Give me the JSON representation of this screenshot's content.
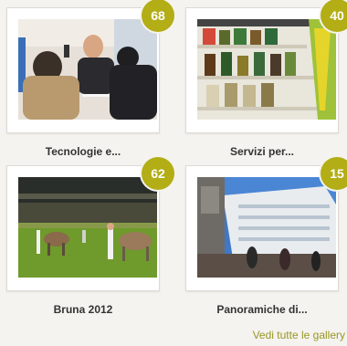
{
  "galleries": [
    {
      "title": "Tecnologie e...",
      "count": "68",
      "thumb_icon": "conference-photo"
    },
    {
      "title": "Servizi per...",
      "count": "40",
      "thumb_icon": "shelf-bottles-photo"
    },
    {
      "title": "Bruna 2012",
      "count": "62",
      "thumb_icon": "cattle-arena-photo"
    },
    {
      "title": "Panoramiche di...",
      "count": "15",
      "thumb_icon": "building-panorama-photo"
    }
  ],
  "footer": {
    "all_galleries_link": "Vedi tutte le gallery"
  },
  "colors": {
    "badge": "#b3ad16",
    "link": "#9a9624",
    "background": "#f4f3ef"
  }
}
